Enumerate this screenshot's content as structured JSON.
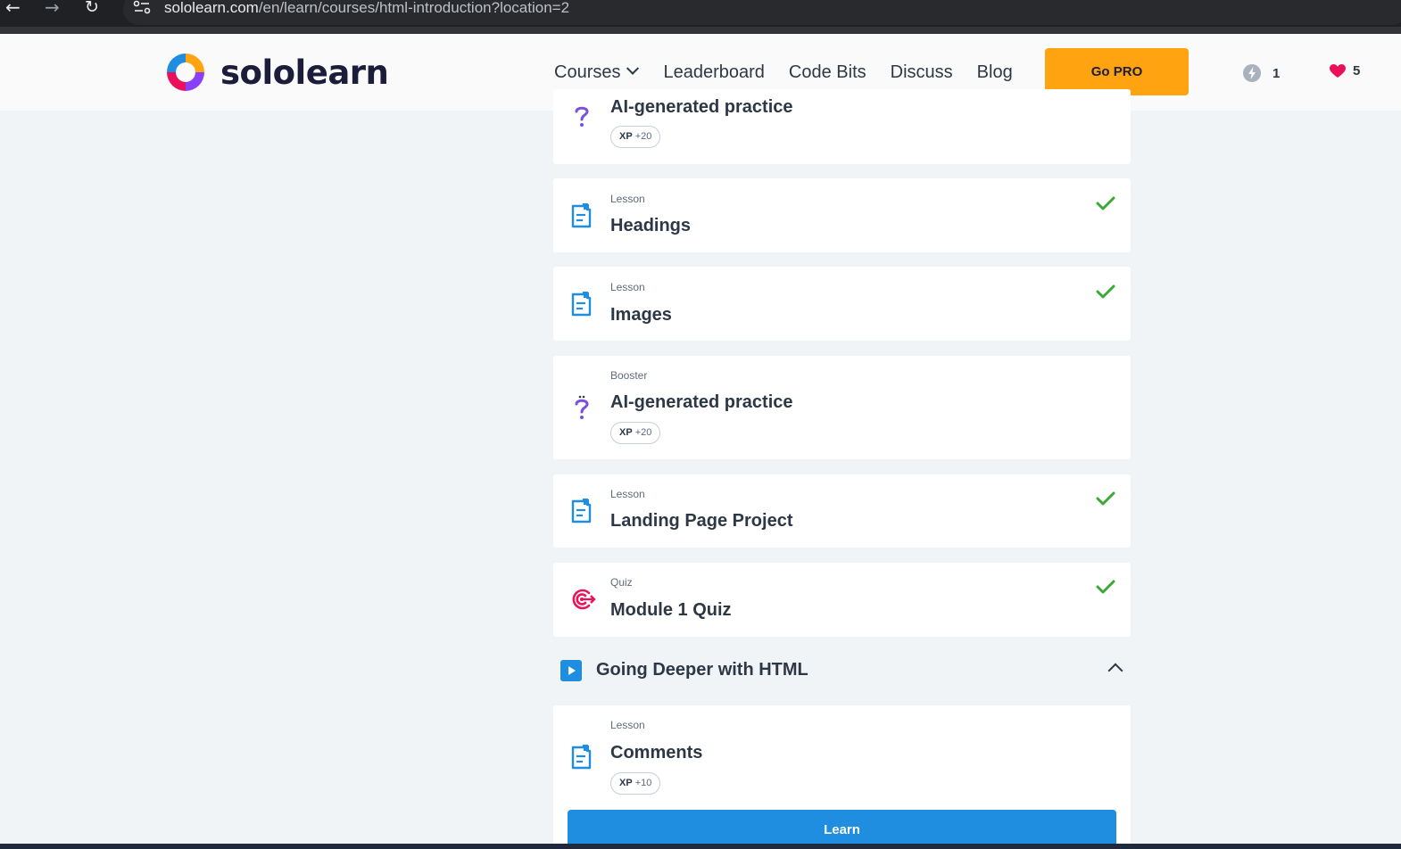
{
  "browser": {
    "url_host": "sololearn.com",
    "url_path": "/en/learn/courses/html-introduction?location=2",
    "back_icon": "arrow-left-icon",
    "forward_icon": "arrow-right-icon",
    "reload_icon": "reload-icon"
  },
  "header": {
    "logo_text": "sololearn",
    "nav": {
      "courses": "Courses",
      "leaderboard": "Leaderboard",
      "code_bits": "Code Bits",
      "discuss": "Discuss",
      "blog": "Blog"
    },
    "go_pro": "Go PRO",
    "streak_count": "1",
    "hearts_count": "5"
  },
  "items": [
    {
      "type": "",
      "title": "AI-generated practice",
      "xp": "+20",
      "icon": "question-icon",
      "completed": false
    },
    {
      "type": "Lesson",
      "title": "Headings",
      "icon": "lesson-icon",
      "completed": true
    },
    {
      "type": "Lesson",
      "title": "Images",
      "icon": "lesson-icon",
      "completed": true
    },
    {
      "type": "Booster",
      "title": "AI-generated practice",
      "xp": "+20",
      "icon": "question-icon",
      "completed": false
    },
    {
      "type": "Lesson",
      "title": "Landing Page Project",
      "icon": "lesson-icon",
      "completed": true
    },
    {
      "type": "Quiz",
      "title": "Module 1 Quiz",
      "icon": "target-icon",
      "completed": true
    }
  ],
  "section": {
    "title": "Going Deeper with HTML"
  },
  "current": {
    "type": "Lesson",
    "title": "Comments",
    "xp": "+10",
    "learn_label": "Learn"
  },
  "xp_label": "XP",
  "colors": {
    "accent_blue": "#1f8de0",
    "pro_orange": "#ffa310",
    "check_green": "#3aaa35",
    "booster_purple": "#7b4fdc",
    "quiz_red": "#e8115a",
    "heart_red": "#e8115a"
  }
}
